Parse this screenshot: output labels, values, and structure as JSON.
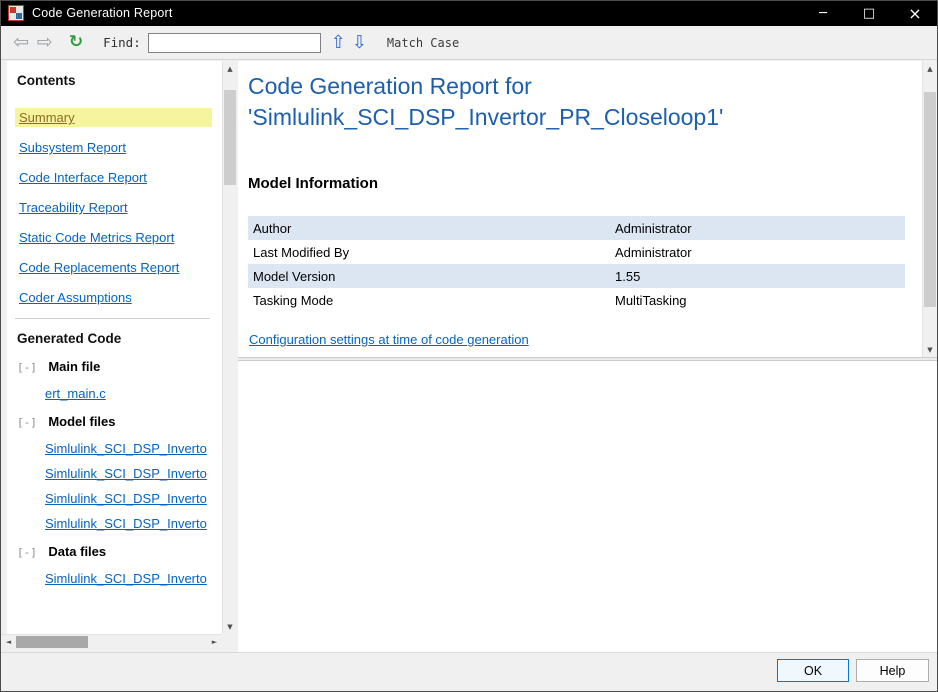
{
  "window": {
    "title": "Code Generation Report"
  },
  "icons": {
    "minimize": "─",
    "maximize": "□",
    "close": "×",
    "back": "⇦",
    "forward": "⇨",
    "refresh": "↻",
    "find_prev": "⇧",
    "find_next": "⇩",
    "scroll_up": "▲",
    "scroll_down": "▼",
    "scroll_left": "◄",
    "scroll_right": "►",
    "tree_collapse": "[-]"
  },
  "toolbar": {
    "find_label": "Find:",
    "find_value": "",
    "match_case_label": "Match Case"
  },
  "sidebar": {
    "contents_heading": "Contents",
    "links": [
      {
        "label": "Summary",
        "active": true
      },
      {
        "label": "Subsystem Report"
      },
      {
        "label": "Code Interface Report"
      },
      {
        "label": "Traceability Report"
      },
      {
        "label": "Static Code Metrics Report"
      },
      {
        "label": "Code Replacements Report"
      },
      {
        "label": "Coder Assumptions"
      }
    ],
    "generated_heading": "Generated Code",
    "groups": [
      {
        "label": "Main file",
        "files": [
          "ert_main.c"
        ]
      },
      {
        "label": "Model files",
        "files": [
          "Simlulink_SCI_DSP_Inverto",
          "Simlulink_SCI_DSP_Inverto",
          "Simlulink_SCI_DSP_Inverto",
          "Simlulink_SCI_DSP_Inverto"
        ]
      },
      {
        "label": "Data files",
        "files": [
          "Simlulink_SCI_DSP_Inverto"
        ]
      }
    ]
  },
  "main": {
    "title_line1": "Code Generation Report for",
    "title_line2": "'Simlulink_SCI_DSP_Invertor_PR_Closeloop1'",
    "section_heading": "Model Information",
    "info_rows": [
      {
        "label": "Author",
        "value": "Administrator"
      },
      {
        "label": "Last Modified By",
        "value": "Administrator"
      },
      {
        "label": "Model Version",
        "value": "1.55"
      },
      {
        "label": "Tasking Mode",
        "value": "MultiTasking"
      }
    ],
    "config_link": "Configuration settings at time of code generation"
  },
  "footer": {
    "ok_label": "OK",
    "help_label": "Help"
  },
  "colors": {
    "link_blue": "#0563c1",
    "title_blue": "#1d5fae",
    "toc_highlight": "#f7f49f",
    "active_link_text": "#8a6d1a",
    "table_alt_row": "#dce6f2",
    "default_button_border": "#0078d7",
    "titlebar_bg": "#000000"
  }
}
